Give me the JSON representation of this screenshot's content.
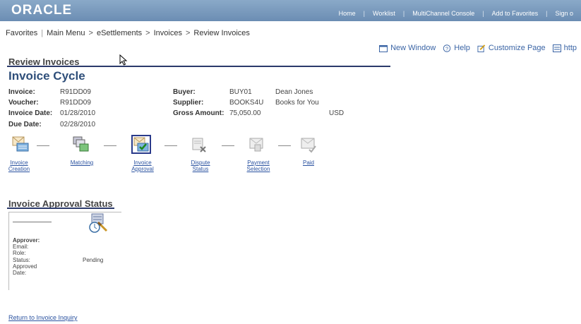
{
  "banner": {
    "logo": "ORACLE",
    "nav": [
      "Home",
      "Worklist",
      "MultiChannel Console",
      "Add to Favorites",
      "Sign o"
    ]
  },
  "breadcrumb": {
    "favorites": "Favorites",
    "main_menu": "Main Menu",
    "esettlements": "eSettlements",
    "invoices": "Invoices",
    "review_invoices": "Review Invoices"
  },
  "pagebar": {
    "new_window": "New Window",
    "help": "Help",
    "customize": "Customize Page",
    "http": "http"
  },
  "section_title": "Review Invoices",
  "page_title": "Invoice Cycle",
  "invoice": {
    "invoice_label": "Invoice:",
    "invoice_value": "R91DD09",
    "voucher_label": "Voucher:",
    "voucher_value": "R91DD09",
    "invoice_date_label": "Invoice Date:",
    "invoice_date_value": "01/28/2010",
    "due_date_label": "Due Date:",
    "due_date_value": "02/28/2010",
    "buyer_label": "Buyer:",
    "buyer_id": "BUY01",
    "buyer_name": "Dean Jones",
    "supplier_label": "Supplier:",
    "supplier_id": "BOOKS4U",
    "supplier_name": "Books for You",
    "gross_label": "Gross Amount:",
    "gross_value": "75,050.00",
    "currency": "USD"
  },
  "steps": [
    {
      "line1": "Invoice",
      "line2": "Creation",
      "icon": "invoice-creation-icon"
    },
    {
      "line1": "Matching",
      "line2": "",
      "icon": "matching-icon"
    },
    {
      "line1": "Invoice",
      "line2": "Approval",
      "icon": "invoice-approval-icon"
    },
    {
      "line1": "Dispute",
      "line2": "Status",
      "icon": "dispute-status-icon"
    },
    {
      "line1": "Payment",
      "line2": "Selection",
      "icon": "payment-selection-icon"
    },
    {
      "line1": "Paid",
      "line2": "",
      "icon": "paid-icon"
    }
  ],
  "approval": {
    "title": "Invoice Approval Status",
    "approver_label": "Approver:",
    "email_label": "Email:",
    "role_label": "Role:",
    "status_label": "Status:",
    "status_value": "Pending",
    "approved_label": "Approved",
    "date_label": "Date:"
  },
  "return_link": "Return to Invoice Inquiry",
  "colors": {
    "banner": "#7a9bbf",
    "link": "#2a52a0",
    "title": "#2f4f7a",
    "rule": "#2b3a6b"
  }
}
